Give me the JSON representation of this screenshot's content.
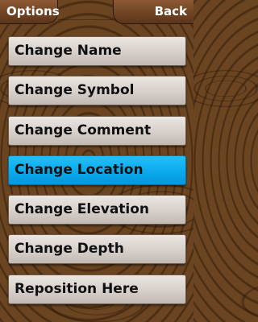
{
  "header": {
    "options_label": "Options",
    "back_label": "Back"
  },
  "menu": {
    "selected_index": 3,
    "items": [
      {
        "label": "Change Name"
      },
      {
        "label": "Change Symbol"
      },
      {
        "label": "Change Comment"
      },
      {
        "label": "Change Location"
      },
      {
        "label": "Change Elevation"
      },
      {
        "label": "Change Depth"
      },
      {
        "label": "Reposition Here"
      }
    ]
  },
  "colors": {
    "background": "#5a3a1c",
    "button_face": "#d6cfca",
    "selected_accent": "#0aa8ec",
    "header_text": "#ffffff"
  }
}
